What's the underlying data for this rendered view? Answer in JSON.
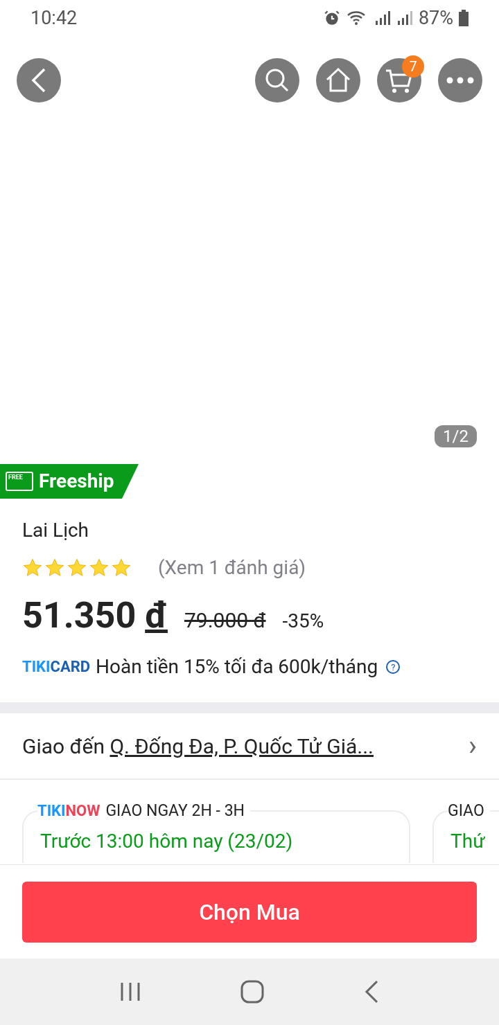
{
  "status_bar": {
    "time": "10:42",
    "battery": "87%"
  },
  "top_bar": {
    "cart_count": "7"
  },
  "gallery": {
    "counter": "1/2"
  },
  "freeship_badge": {
    "icon_text": "FREE",
    "label": "Freeship"
  },
  "product": {
    "title": "Lai Lịch",
    "stars": 5,
    "reviews_link": "(Xem 1 đánh giá)",
    "price": "51.350",
    "currency": "đ",
    "old_price": "79.000 đ",
    "discount": "-35%"
  },
  "tikicard": {
    "logo_left": "TIKI",
    "logo_right": "CARD",
    "text": "Hoàn tiền 15% tối đa 600k/tháng",
    "help": "?"
  },
  "delivery": {
    "label": "Giao đến",
    "address": "Q. Đống Đa, P. Quốc Tử Giá...",
    "chevron": "›"
  },
  "delivery_options": [
    {
      "logo_left": "TIKI",
      "logo_right": "NOW",
      "title": "GIAO NGAY 2H - 3H",
      "time": "Trước 13:00 hôm nay (23/02)"
    },
    {
      "title": "GIAO",
      "time": "Thứ"
    }
  ],
  "buy_button": "Chọn Mua"
}
